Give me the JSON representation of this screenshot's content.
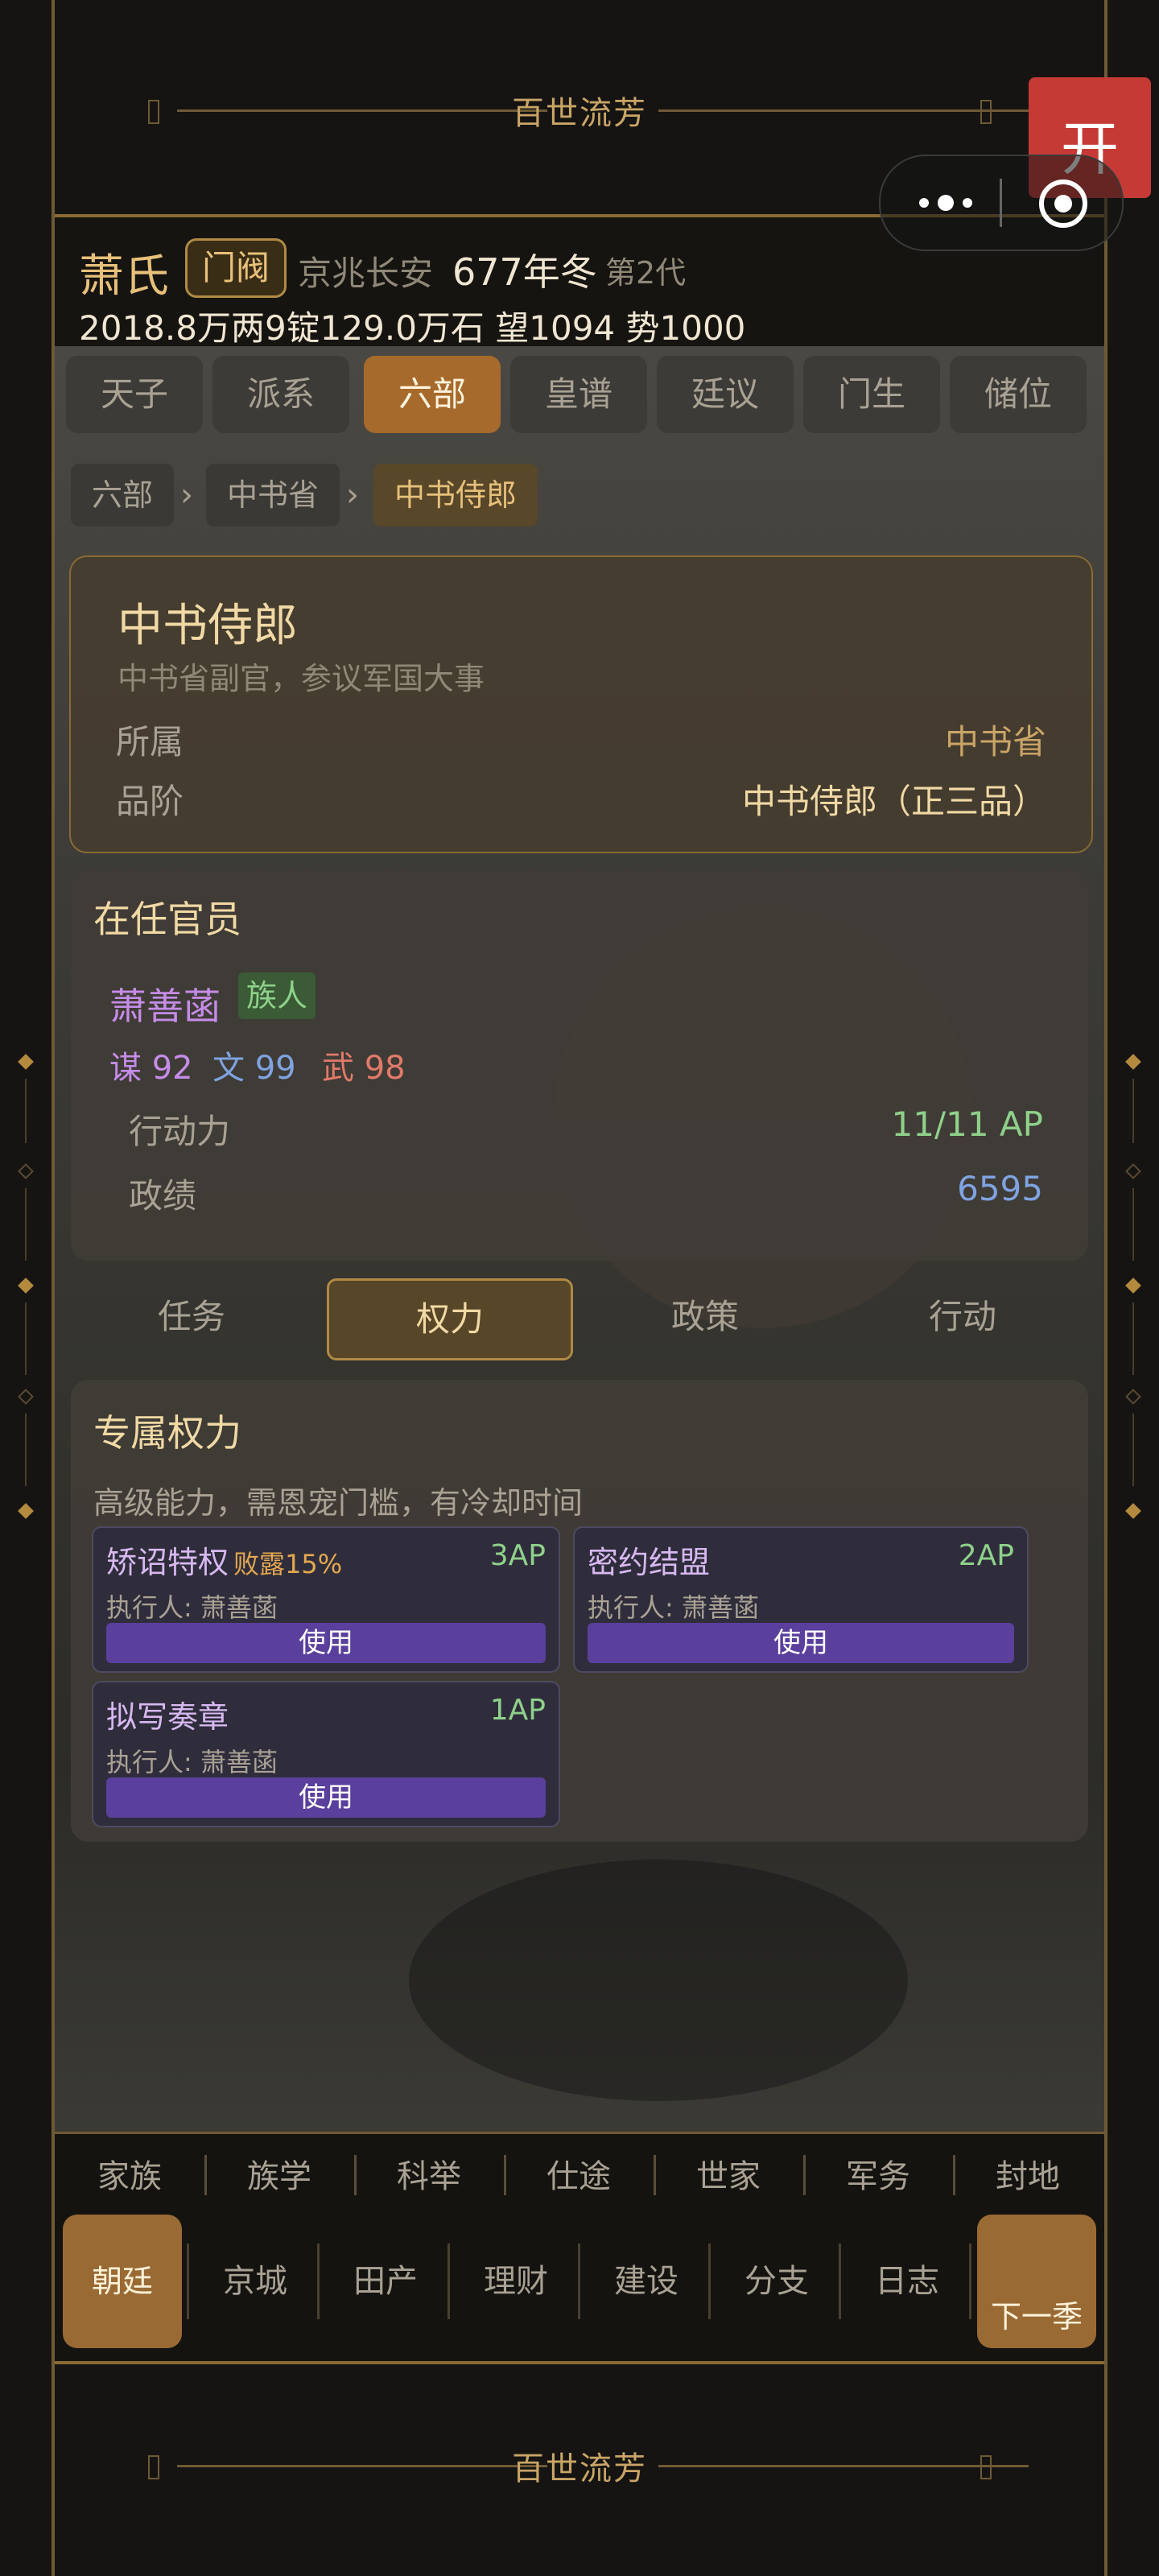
{
  "banner": {
    "title": "百世流芳"
  },
  "header": {
    "surname": "萧氏",
    "clan_badge": "门阀",
    "location": "京兆长安",
    "year": "677年冬",
    "generation": "第2代",
    "stats": "2018.8万两9锭129.0万石  望1094  势1000"
  },
  "top_tabs": [
    "天子",
    "派系",
    "六部",
    "皇谱",
    "廷议",
    "门生",
    "储位"
  ],
  "active_top_tab": "六部",
  "breadcrumb": [
    "六部",
    "中书省",
    "中书侍郎"
  ],
  "breadcrumb_sep": "›",
  "office": {
    "title": "中书侍郎",
    "subtitle": "中书省副官，参议军国大事",
    "belongs_label": "所属",
    "belongs_value": "中书省",
    "rank_label": "品阶",
    "rank_value": "中书侍郎（正三品）"
  },
  "officer_section": {
    "title": "在任官员",
    "name": "萧善菡",
    "tag": "族人",
    "attr_mou": "谋 92",
    "attr_wen": "文 99",
    "attr_wu": "武 98",
    "ap_label": "行动力",
    "ap_value": "11/11 AP",
    "merit_label": "政绩",
    "merit_value": "6595"
  },
  "sub_tabs": [
    "任务",
    "权力",
    "政策",
    "行动"
  ],
  "active_sub_tab": "权力",
  "powers_section": {
    "title": "专属权力",
    "desc": "高级能力，需恩宠门槛，有冷却时间",
    "items": [
      {
        "name": "矫诏特权",
        "warn": "败露15%",
        "ap": "3AP",
        "executor": "执行人: 萧善菡",
        "button": "使用"
      },
      {
        "name": "密约结盟",
        "warn": "",
        "ap": "2AP",
        "executor": "执行人: 萧善菡",
        "button": "使用"
      },
      {
        "name": "拟写奏章",
        "warn": "",
        "ap": "1AP",
        "executor": "执行人: 萧善菡",
        "button": "使用"
      }
    ]
  },
  "bottom_nav_top": [
    "家族",
    "族学",
    "科举",
    "仕途",
    "世家",
    "军务",
    "封地"
  ],
  "bottom_nav_main": {
    "left_button": "朝廷",
    "items": [
      "京城",
      "田产",
      "理财",
      "建设",
      "分支",
      "日志"
    ],
    "right_button": "下一季"
  },
  "overlay": {
    "red_label": "开"
  },
  "colors": {
    "accent_gold": "#e7c07a",
    "active_tab": "#a56a2c",
    "use_button": "#5a3f9c",
    "ap_green": "#8fd18b",
    "merit_blue": "#7fa3e0",
    "attr_mou": "#c58ce8",
    "attr_wen": "#7fa3e0",
    "attr_wu": "#e07a6a"
  }
}
